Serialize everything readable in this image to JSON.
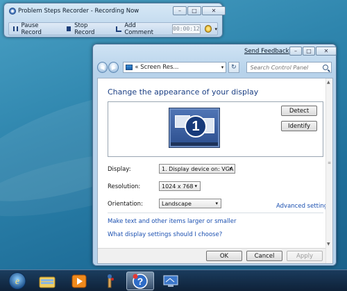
{
  "psr": {
    "title": "Problem Steps Recorder - Recording Now",
    "pause_label": "Pause Record",
    "stop_label": "Stop Record",
    "comment_label": "Add Comment",
    "timer": "00:00:12"
  },
  "control_panel": {
    "send_feedback": "Send Feedback",
    "address": "« Screen Res...",
    "search_placeholder": "Search Control Panel",
    "heading": "Change the appearance of your display",
    "monitor_number": "1",
    "detect_label": "Detect",
    "identify_label": "Identify",
    "display_label": "Display:",
    "display_value": "1. Display device on: VGA",
    "resolution_label": "Resolution:",
    "resolution_value": "1024 x 768",
    "orientation_label": "Orientation:",
    "orientation_value": "Landscape",
    "advanced_link": "Advanced settings",
    "link_text_size": "Make text and other items larger or smaller",
    "link_which_settings": "What display settings should I choose?",
    "ok_label": "OK",
    "cancel_label": "Cancel",
    "apply_label": "Apply"
  },
  "taskbar": {
    "items": [
      "start-orb",
      "internet-explorer",
      "windows-explorer",
      "media-player",
      "problem-steps-recorder",
      "help-and-support",
      "control-panel"
    ]
  },
  "icons": {
    "minimize": "–",
    "maximize": "□",
    "close": "✕",
    "back": "◀",
    "forward": "▶",
    "dropdown": "▾",
    "refresh": "↻"
  }
}
